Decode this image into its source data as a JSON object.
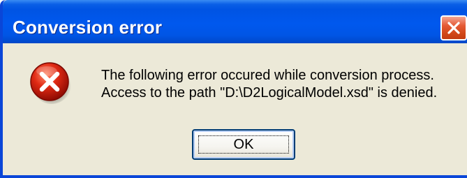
{
  "dialog": {
    "title": "Conversion error",
    "icon": "error-icon",
    "message_lines": [
      "The following error occured while conversion process.",
      "Access to the path \"D:\\D2LogicalModel.xsd\" is denied."
    ],
    "ok_label": "OK",
    "close_icon": "close-icon"
  },
  "colors": {
    "titlebar": "#0054e3",
    "dialog_face": "#ece9d8",
    "close_button": "#d14718",
    "error_red": "#c8140c"
  }
}
